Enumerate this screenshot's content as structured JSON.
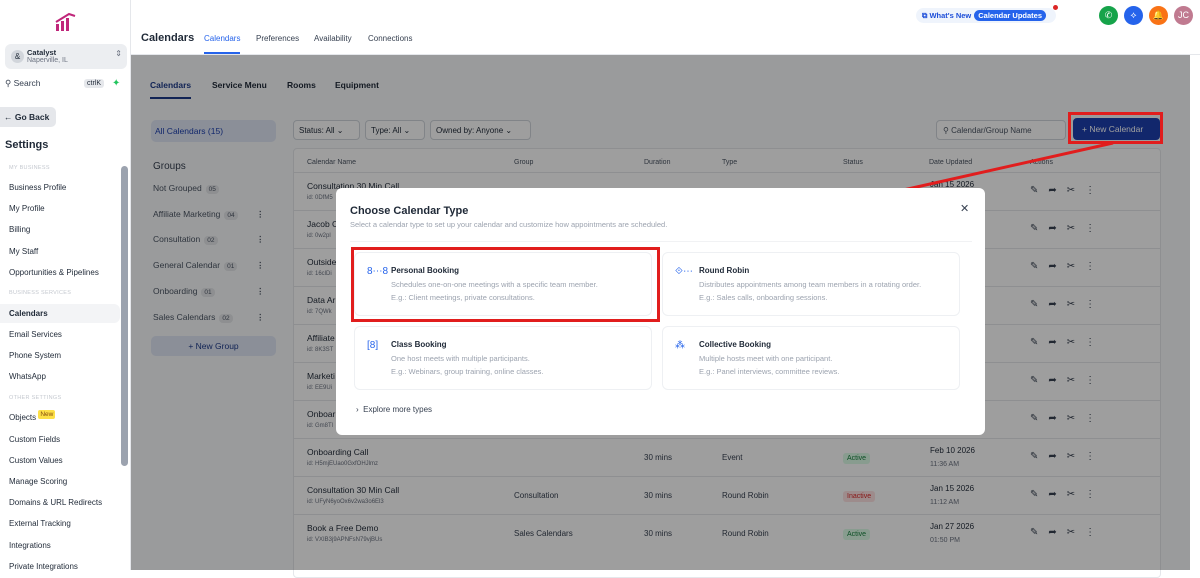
{
  "sidebar": {
    "account": {
      "name": "Catalyst",
      "location": "Naperville, IL",
      "initial": "&"
    },
    "search": "Search",
    "shortcut": "ctrlK",
    "go_back": "← Go Back",
    "title": "Settings",
    "sections": [
      "MY BUSINESS",
      "BUSINESS SERVICES",
      "OTHER SETTINGS"
    ],
    "items": [
      "Business Profile",
      "My Profile",
      "Billing",
      "My Staff",
      "Opportunities & Pipelines",
      "Calendars",
      "Email Services",
      "Phone System",
      "WhatsApp",
      "Objects",
      "Custom Fields",
      "Custom Values",
      "Manage Scoring",
      "Domains & URL Redirects",
      "External Tracking",
      "Integrations",
      "Private Integrations"
    ],
    "new_badge": "New"
  },
  "header": {
    "title": "Calendars",
    "tabs": [
      "Calendars",
      "Preferences",
      "Availability",
      "Connections"
    ],
    "whats_new": "What's New",
    "updates": "Calendar Updates",
    "avatar": "JC"
  },
  "main": {
    "tabs": [
      "Calendars",
      "Service Menu",
      "Rooms",
      "Equipment"
    ],
    "all_calendars": "All Calendars (15)",
    "groups_title": "Groups",
    "groups": [
      {
        "name": "Not Grouped",
        "count": "05"
      },
      {
        "name": "Affiliate Marketing",
        "count": "04"
      },
      {
        "name": "Consultation",
        "count": "02"
      },
      {
        "name": "General Calendar",
        "count": "01"
      },
      {
        "name": "Onboarding",
        "count": "01"
      },
      {
        "name": "Sales Calendars",
        "count": "02"
      }
    ],
    "new_group": "+ New Group",
    "filters": [
      "Status: All",
      "Type: All",
      "Owned by: Anyone"
    ],
    "search_placeholder": "Calendar/Group Name",
    "new_calendar": "New Calendar",
    "columns": [
      "Calendar Name",
      "Group",
      "Duration",
      "Type",
      "Status",
      "Date Updated",
      "Actions"
    ],
    "rows": [
      {
        "name": "Consultation 30 Min Call",
        "id": "id: 0DfM5",
        "group": "",
        "duration": "",
        "type": "",
        "status": "",
        "date": "Jan 15 2026",
        "time": ""
      },
      {
        "name": "Jacob C",
        "id": "id: 0w2pl"
      },
      {
        "name": "Outside",
        "id": "id: 16clDi"
      },
      {
        "name": "Data Ar",
        "id": "id: 7QWk"
      },
      {
        "name": "Affiliate",
        "id": "id: 8K3ST"
      },
      {
        "name": "Marketi",
        "id": "id: EE9Ui"
      },
      {
        "name": "Onboar",
        "id": "id: Gm8Tl"
      },
      {
        "name": "Onboarding Call",
        "id": "id: H5mjEUao0GxfOHJlmz",
        "group": "",
        "duration": "30 mins",
        "type": "Event",
        "status": "Active",
        "date": "Feb 10 2026",
        "time": "11:36 AM"
      },
      {
        "name": "Consultation 30 Min Call",
        "id": "id: UFyN6yoOx6v2wa3o6El3",
        "group": "Consultation",
        "duration": "30 mins",
        "type": "Round Robin",
        "status": "Inactive",
        "date": "Jan 15 2026",
        "time": "11:12 AM"
      },
      {
        "name": "Book a Free Demo",
        "id": "id: VXIB3j9APNFsN79vjBUs",
        "group": "Sales Calendars",
        "duration": "30 mins",
        "type": "Round Robin",
        "status": "Active",
        "date": "Jan 27 2026",
        "time": "01:50 PM"
      }
    ]
  },
  "modal": {
    "title": "Choose Calendar Type",
    "subtitle": "Select a calendar type to set up your calendar and customize how appointments are scheduled.",
    "options": [
      {
        "title": "Personal Booking",
        "desc": "Schedules one-on-one meetings with a specific team member.",
        "example": "E.g.: Client meetings, private consultations."
      },
      {
        "title": "Round Robin",
        "desc": "Distributes appointments among team members in a rotating order.",
        "example": "E.g.: Sales calls, onboarding sessions."
      },
      {
        "title": "Class Booking",
        "desc": "One host meets with multiple participants.",
        "example": "E.g.: Webinars, group training, online classes."
      },
      {
        "title": "Collective Booking",
        "desc": "Multiple hosts meet with one participant.",
        "example": "E.g.: Panel interviews, committee reviews."
      }
    ],
    "explore": "Explore more types"
  },
  "colors": {
    "accent": "#1e40af",
    "highlight": "#e11d1d"
  }
}
